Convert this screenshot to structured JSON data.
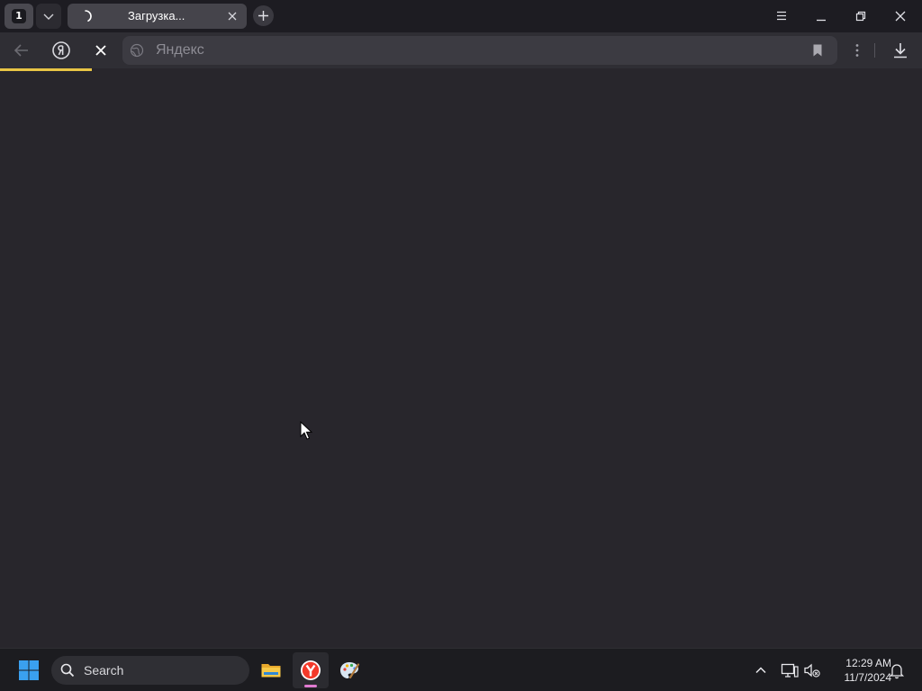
{
  "browser": {
    "tab_count": "1",
    "active_tab": {
      "title": "Загрузка...",
      "loading": true
    },
    "address_bar": {
      "text": "Яндекс"
    },
    "accent_color": "#e8c545",
    "page_load_progress": 0.1
  },
  "taskbar": {
    "search_label": "Search",
    "pinned_apps": [
      "file-explorer",
      "yandex-browser",
      "paint"
    ],
    "active_app": "yandex-browser",
    "clock": {
      "time": "12:29 AM",
      "date": "11/7/2024"
    }
  },
  "icons": {
    "tab_list": "chevron-down-icon",
    "new_tab": "plus-icon",
    "menu": "hamburger-menu-icon",
    "minimize": "minimize-icon",
    "restore": "restore-icon",
    "close": "close-icon",
    "back": "arrow-left-icon",
    "yandex": "yandex-logo-icon",
    "stop": "stop-loading-icon",
    "site": "globe-icon",
    "bookmark": "bookmark-icon",
    "more": "vertical-dots-icon",
    "downloads": "download-icon"
  }
}
